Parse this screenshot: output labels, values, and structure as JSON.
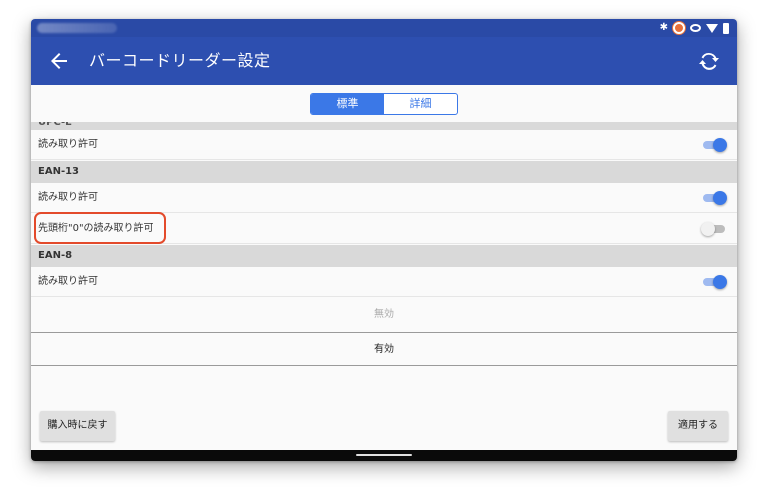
{
  "appbar": {
    "title": "バーコードリーダー設定"
  },
  "tabs": [
    {
      "label": "標準",
      "active": true
    },
    {
      "label": "詳細",
      "active": false
    }
  ],
  "sections": {
    "upce": {
      "header": "UPC-E",
      "row_label": "読み取り許可",
      "enabled": true
    },
    "ean13": {
      "header": "EAN-13",
      "rows": [
        {
          "label": "読み取り許可",
          "enabled": true
        },
        {
          "label": "先頭桁\"0\"の読み取り許可",
          "enabled": false
        }
      ]
    },
    "ean8": {
      "header": "EAN-8",
      "row_label": "読み取り許可",
      "enabled": true
    }
  },
  "options": {
    "disabled_label": "無効",
    "enabled_label": "有効"
  },
  "buttons": {
    "reset": "購入時に戻す",
    "apply": "適用する"
  },
  "colors": {
    "appbar": "#2d4fb0",
    "accent": "#3b78e7",
    "highlight": "#e34a2b"
  },
  "icons": {
    "back": "arrow-back-icon",
    "refresh": "refresh-icon"
  }
}
